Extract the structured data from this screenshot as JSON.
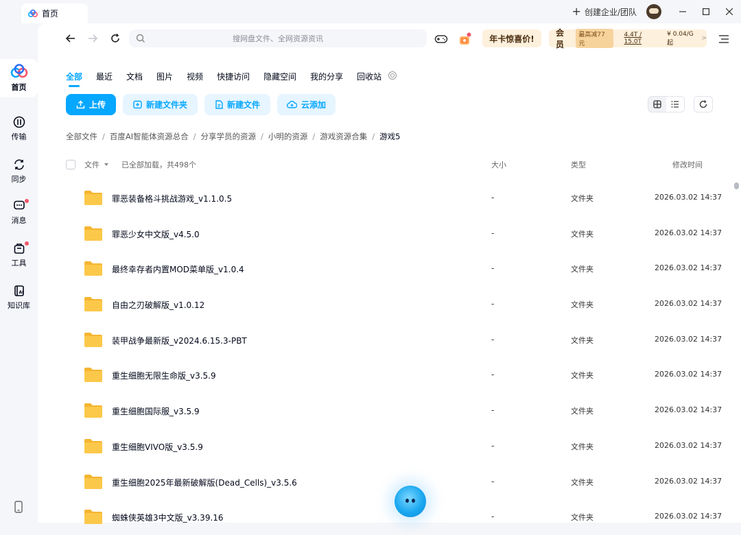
{
  "window": {
    "tab_title": "首页",
    "create_team": "创建企业/团队"
  },
  "sidebar": {
    "items": [
      {
        "label": "首页",
        "icon": "baidu-cloud-logo-icon",
        "active": true
      },
      {
        "label": "传输",
        "icon": "transfer-icon",
        "badge": false
      },
      {
        "label": "同步",
        "icon": "sync-icon",
        "badge": false
      },
      {
        "label": "消息",
        "icon": "message-icon",
        "badge": true
      },
      {
        "label": "工具",
        "icon": "toolbox-icon",
        "badge": true
      },
      {
        "label": "知识库",
        "icon": "knowledge-base-icon",
        "badge": false
      }
    ]
  },
  "search": {
    "placeholder": "搜网盘文件、全网资源资讯"
  },
  "header": {
    "promo": "年卡惊喜价!",
    "vip_label": "会员",
    "vip_badge": "最高减77元",
    "quota": "4.4T / 15.0T",
    "price": "¥ 0.04/G起",
    "vip_arrow": ">"
  },
  "category_tabs": [
    {
      "label": "全部",
      "active": true
    },
    {
      "label": "最近"
    },
    {
      "label": "文档"
    },
    {
      "label": "图片"
    },
    {
      "label": "视频"
    },
    {
      "label": "快捷访问"
    },
    {
      "label": "隐藏空间"
    },
    {
      "label": "我的分享"
    },
    {
      "label": "回收站"
    }
  ],
  "actions": {
    "upload": "上传",
    "new_folder": "新建文件夹",
    "new_file": "新建文件",
    "cloud_add": "云添加"
  },
  "breadcrumb": {
    "items": [
      "全部文件",
      "百度AI智能体资源总合",
      "分享学员的资源",
      "小明的资源",
      "游戏资源合集"
    ],
    "current": "游戏5",
    "separator": "/"
  },
  "list_header": {
    "file": "文件",
    "loaded": "已全部加载，共498个",
    "size": "大小",
    "type": "类型",
    "mtime": "修改时间"
  },
  "files": [
    {
      "name": "罪恶装备格斗挑战游戏_v1.1.0.5",
      "size": "-",
      "type": "文件夹",
      "mtime": "2026.03.02 14:37"
    },
    {
      "name": "罪恶少女中文版_v4.5.0",
      "size": "-",
      "type": "文件夹",
      "mtime": "2026.03.02 14:37"
    },
    {
      "name": "最终幸存者内置MOD菜单版_v1.0.4",
      "size": "-",
      "type": "文件夹",
      "mtime": "2026.03.02 14:37"
    },
    {
      "name": "自由之刃破解版_v1.0.12",
      "size": "-",
      "type": "文件夹",
      "mtime": "2026.03.02 14:37"
    },
    {
      "name": "装甲战争最新版_v2024.6.15.3-PBT",
      "size": "-",
      "type": "文件夹",
      "mtime": "2026.03.02 14:37"
    },
    {
      "name": "重生细胞无限生命版_v3.5.9",
      "size": "-",
      "type": "文件夹",
      "mtime": "2026.03.02 14:37"
    },
    {
      "name": "重生细胞国际服_v3.5.9",
      "size": "-",
      "type": "文件夹",
      "mtime": "2026.03.02 14:37"
    },
    {
      "name": "重生细胞VIVO版_v3.5.9",
      "size": "-",
      "type": "文件夹",
      "mtime": "2026.03.02 14:37"
    },
    {
      "name": "重生细胞2025年最新破解版(Dead_Cells)_v3.5.6",
      "size": "-",
      "type": "文件夹",
      "mtime": "2026.03.02 14:37"
    },
    {
      "name": "蜘蛛侠英雄3中文版_v3.39.16",
      "size": "-",
      "type": "文件夹",
      "mtime": "2026.03.02 14:37"
    }
  ],
  "colors": {
    "accent": "#06a7ff",
    "accent_light": "#e6f5ff",
    "folder": "#fcc84a",
    "badge_red": "#f2556b",
    "vip_bg": "#fdf0dc"
  }
}
